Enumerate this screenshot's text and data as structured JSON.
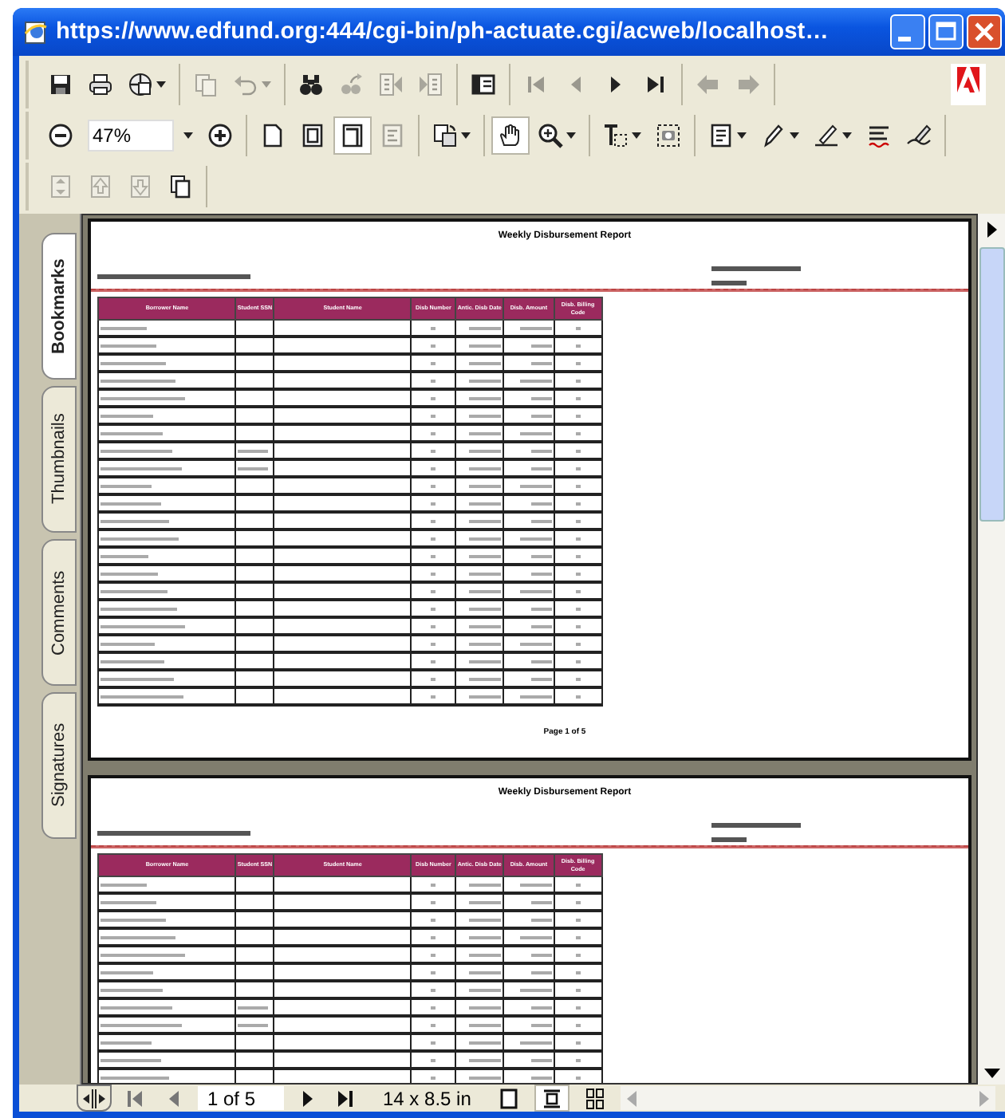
{
  "window": {
    "title": "https://www.edfund.org:444/cgi-bin/ph-actuate.cgi/acweb/localhost…"
  },
  "toolbars": [
    {
      "groups": [
        [
          {
            "kind": "save",
            "pressed": false,
            "disabled": false,
            "menu": false
          },
          {
            "kind": "print",
            "pressed": false,
            "disabled": false,
            "menu": false
          },
          {
            "kind": "email",
            "pressed": false,
            "disabled": false,
            "menu": true
          }
        ],
        [
          {
            "kind": "copy",
            "pressed": false,
            "disabled": true,
            "menu": false
          },
          {
            "kind": "undo",
            "pressed": false,
            "disabled": true,
            "menu": true
          }
        ],
        [
          {
            "kind": "find",
            "pressed": false,
            "disabled": false,
            "menu": false
          },
          {
            "kind": "websearch",
            "pressed": false,
            "disabled": true,
            "menu": false
          },
          {
            "kind": "prevdoc",
            "pressed": false,
            "disabled": true,
            "menu": false
          },
          {
            "kind": "nextdoc",
            "pressed": false,
            "disabled": true,
            "menu": false
          }
        ],
        [
          {
            "kind": "panel",
            "pressed": false,
            "disabled": false,
            "menu": false
          }
        ],
        [
          {
            "kind": "first",
            "pressed": false,
            "disabled": true,
            "menu": false
          },
          {
            "kind": "previous",
            "pressed": false,
            "disabled": true,
            "menu": false
          },
          {
            "kind": "next",
            "pressed": false,
            "disabled": false,
            "menu": false
          },
          {
            "kind": "last",
            "pressed": false,
            "disabled": false,
            "menu": false
          }
        ],
        [
          {
            "kind": "back",
            "pressed": false,
            "disabled": true,
            "menu": false
          },
          {
            "kind": "forward",
            "pressed": false,
            "disabled": true,
            "menu": false
          }
        ]
      ]
    },
    {
      "groups": [
        [
          {
            "kind": "zoomout",
            "pressed": false,
            "disabled": false,
            "menu": false
          },
          {
            "kind": "zoomfield",
            "value": "47%"
          },
          {
            "kind": "zoomin",
            "pressed": false,
            "disabled": false,
            "menu": false
          }
        ],
        [
          {
            "kind": "actualsize",
            "pressed": false,
            "disabled": false,
            "menu": false
          },
          {
            "kind": "fitpage",
            "pressed": false,
            "disabled": false,
            "menu": false
          },
          {
            "kind": "fitwidth",
            "pressed": true,
            "disabled": false,
            "menu": false
          },
          {
            "kind": "reflow",
            "pressed": false,
            "disabled": true,
            "menu": false
          }
        ],
        [
          {
            "kind": "rotate",
            "pressed": false,
            "disabled": false,
            "menu": true
          }
        ],
        [
          {
            "kind": "hand",
            "pressed": true,
            "disabled": false,
            "menu": false
          },
          {
            "kind": "magnify",
            "pressed": false,
            "disabled": false,
            "menu": true
          }
        ],
        [
          {
            "kind": "textselect",
            "pressed": false,
            "disabled": false,
            "menu": true
          },
          {
            "kind": "snapshot",
            "pressed": false,
            "disabled": false,
            "menu": false
          }
        ],
        [
          {
            "kind": "note",
            "pressed": false,
            "disabled": false,
            "menu": true
          },
          {
            "kind": "pencil",
            "pressed": false,
            "disabled": false,
            "menu": true
          },
          {
            "kind": "highlighter",
            "pressed": false,
            "disabled": false,
            "menu": true
          },
          {
            "kind": "spell",
            "pressed": false,
            "disabled": false,
            "menu": false
          },
          {
            "kind": "sign",
            "pressed": false,
            "disabled": false,
            "menu": false
          }
        ]
      ]
    },
    {
      "groups": [
        [
          {
            "kind": "expand",
            "pressed": false,
            "disabled": true,
            "menu": false
          },
          {
            "kind": "moveup",
            "pressed": false,
            "disabled": true,
            "menu": false
          },
          {
            "kind": "movedown",
            "pressed": false,
            "disabled": true,
            "menu": false
          },
          {
            "kind": "pages",
            "pressed": false,
            "disabled": false,
            "menu": false
          }
        ]
      ]
    }
  ],
  "side_tabs": [
    {
      "label": "Bookmarks",
      "selected": true
    },
    {
      "label": "Thumbnails",
      "selected": false
    },
    {
      "label": "Comments",
      "selected": false
    },
    {
      "label": "Signatures",
      "selected": false
    }
  ],
  "pages": [
    {
      "title": "Weekly Disbursement Report",
      "columns": [
        "Borrower Name",
        "Student SSN",
        "Student Name",
        "Disb Number",
        "Antic. Disb Date",
        "Disb. Amount",
        "Disb. Billing Code"
      ],
      "footer": "Page 1 of 5"
    },
    {
      "title": "Weekly Disbursement Report",
      "columns": [
        "Borrower Name",
        "Student SSN",
        "Student Name",
        "Disb Number",
        "Antic. Disb Date",
        "Disb. Amount",
        "Disb. Billing Code"
      ]
    }
  ],
  "status_bar": {
    "page_field": {
      "value": "1 of 5"
    },
    "page_size": "14 x 8.5 in",
    "layouts": [
      {
        "kind": "single",
        "selected": false
      },
      {
        "kind": "continuous",
        "selected": true
      },
      {
        "kind": "facing",
        "selected": false
      }
    ]
  }
}
